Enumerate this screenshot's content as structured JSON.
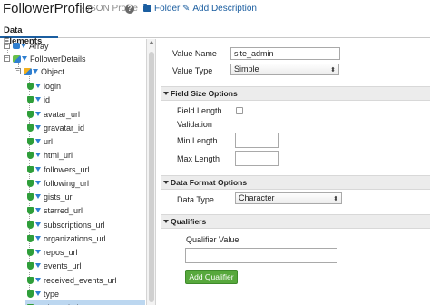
{
  "header": {
    "title": "FollowerProfile",
    "subtitle": "- JSON Profile",
    "help_icon": "?",
    "folder_label": "Folder",
    "add_description_label": "Add Description"
  },
  "tabs": [
    {
      "label": "Data Elements"
    }
  ],
  "tree": {
    "array_label": "Array",
    "follower_details_label": "FollowerDetails",
    "object_label": "Object",
    "fields": [
      "login",
      "id",
      "avatar_url",
      "gravatar_id",
      "url",
      "html_url",
      "followers_url",
      "following_url",
      "gists_url",
      "starred_url",
      "subscriptions_url",
      "organizations_url",
      "repos_url",
      "events_url",
      "received_events_url",
      "type",
      "site_admin"
    ],
    "selected_field": "site_admin"
  },
  "properties": {
    "value_name_label": "Value Name",
    "value_name": "site_admin",
    "value_type_label": "Value Type",
    "value_type": "Simple",
    "field_size_section": "Field Size Options",
    "field_length_label": "Field Length",
    "validation_label": "Validation",
    "min_length_label": "Min Length",
    "max_length_label": "Max Length",
    "data_format_section": "Data Format Options",
    "data_type_label": "Data Type",
    "data_type": "Character",
    "qualifiers_section": "Qualifiers",
    "qualifier_value_label": "Qualifier Value",
    "add_qualifier_label": "Add Qualifier"
  },
  "colors": {
    "accent_blue": "#1b5ea0",
    "selected_row": "#bcd7f0",
    "button_green": "#57a83c"
  }
}
